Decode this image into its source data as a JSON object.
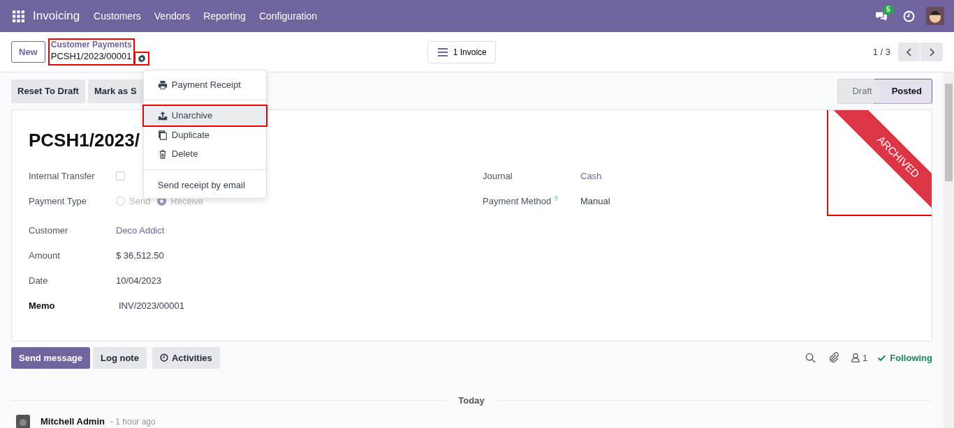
{
  "navbar": {
    "app": "Invoicing",
    "menu": [
      "Customers",
      "Vendors",
      "Reporting",
      "Configuration"
    ],
    "message_count": "5"
  },
  "control_panel": {
    "new_button": "New",
    "breadcrumb": {
      "parent": "Customer Payments",
      "current": "PCSH1/2023/00001",
      "highlighted": true
    },
    "gear_highlighted": true,
    "smart_button": "1 Invoice",
    "pager": "1 / 3"
  },
  "dropdown": {
    "items": [
      {
        "kind": "item",
        "label": "Payment Receipt",
        "active": false,
        "highlighted": false
      },
      {
        "kind": "divider"
      },
      {
        "kind": "item",
        "label": "Unarchive",
        "active": true,
        "highlighted": true
      },
      {
        "kind": "item",
        "label": "Duplicate",
        "active": false,
        "highlighted": false
      },
      {
        "kind": "item",
        "label": "Delete",
        "active": false,
        "highlighted": false
      },
      {
        "kind": "divider"
      },
      {
        "kind": "item",
        "label": "Send receipt by email",
        "active": false,
        "highlighted": false
      }
    ]
  },
  "actions": [
    "Reset To Draft",
    "Mark as S"
  ],
  "statusbar": [
    {
      "label": "Draft",
      "selected": false
    },
    {
      "label": "Posted",
      "selected": true
    }
  ],
  "ribbon": {
    "label": "ARCHIVED",
    "highlighted": true
  },
  "title": "PCSH1/2023/",
  "fields_left": [
    {
      "kind": "checkbox",
      "label": "Internal Transfer",
      "checked": false
    },
    {
      "kind": "radio",
      "label": "Payment Type",
      "options": [
        {
          "label": "Send",
          "selected": false
        },
        {
          "label": "Receive",
          "selected": true
        }
      ]
    },
    {
      "kind": "link",
      "label": "Customer",
      "value": "Deco Addict"
    },
    {
      "kind": "text",
      "label": "Amount",
      "value": "$ 36,512.50"
    },
    {
      "kind": "text",
      "label": "Date",
      "value": "10/04/2023"
    },
    {
      "kind": "text",
      "label": "Memo",
      "value": "INV/2023/00001",
      "strong": true
    }
  ],
  "fields_right": [
    {
      "kind": "link",
      "label": "Journal",
      "value": "Cash"
    },
    {
      "kind": "text",
      "label": "Payment Method",
      "help": "?",
      "value": "Manual"
    }
  ],
  "chatter": {
    "buttons": [
      {
        "label": "Send message",
        "primary": true
      },
      {
        "label": "Log note",
        "primary": false
      },
      {
        "label": "Activities",
        "primary": false
      }
    ],
    "followers": "1",
    "follow": "Following",
    "divider": "Today",
    "message": {
      "author": "Mitchell Admin",
      "time": "- 1 hour ago"
    }
  }
}
